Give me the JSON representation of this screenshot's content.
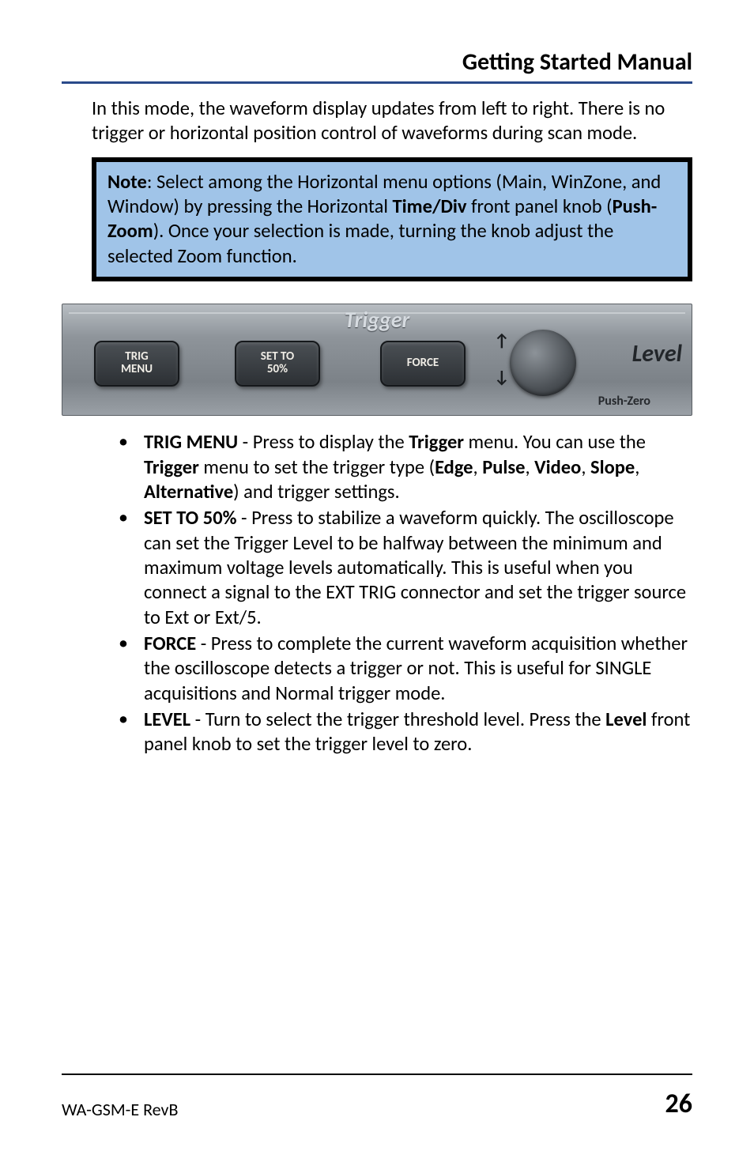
{
  "header": {
    "title": "Getting Started Manual"
  },
  "intro": "In this mode, the waveform display updates from left to right. There is no trigger or horizontal position control of waveforms during scan mode.",
  "note": {
    "label": "Note",
    "text_before_bold1": ": Select among the Horizontal menu options (Main, WinZone, and Window) by pressing the Horizontal ",
    "bold1": "Time/Div",
    "text_mid": " front panel knob (",
    "bold2": "Push-Zoom",
    "text_after": "). Once your selection is made, turning the knob adjust the selected Zoom function."
  },
  "panel": {
    "title": "Trigger",
    "btn_trig_line1": "TRIG",
    "btn_trig_line2": "MENU",
    "btn_set50_line1": "SET TO",
    "btn_set50_line2": "50%",
    "btn_force": "FORCE",
    "level_label": "Level",
    "push_zero": "Push-Zero"
  },
  "bullets": [
    {
      "strong": "TRIG MENU",
      "sep": " - ",
      "rest": "Press to display the <b>Trigger</b> menu. You can use the <b>Trigger</b> menu to set the trigger type (<b>Edge</b>, <b>Pulse</b>, <b>Video</b>, <b>Slope</b>, <b>Alternative</b>) and trigger settings."
    },
    {
      "strong": "SET TO 50%",
      "sep": " - ",
      "rest": "Press to stabilize a waveform quickly. The oscilloscope can set the Trigger Level to be halfway between the minimum and maximum voltage levels automatically. This is useful when you connect a signal to the EXT TRIG connector and set the trigger source to Ext or Ext/5."
    },
    {
      "strong": "FORCE",
      "sep": " - ",
      "rest": "Press to complete the current waveform acquisition whether the oscilloscope detects a trigger or not. This is useful for SINGLE acquisitions and Normal trigger mode."
    },
    {
      "strong": "LEVEL",
      "sep": " - ",
      "rest": "Turn to select the trigger threshold level. Press the <b>Level</b> front panel knob to set the trigger level to zero."
    }
  ],
  "footer": {
    "left": "WA-GSM-E RevB",
    "page": "26"
  }
}
